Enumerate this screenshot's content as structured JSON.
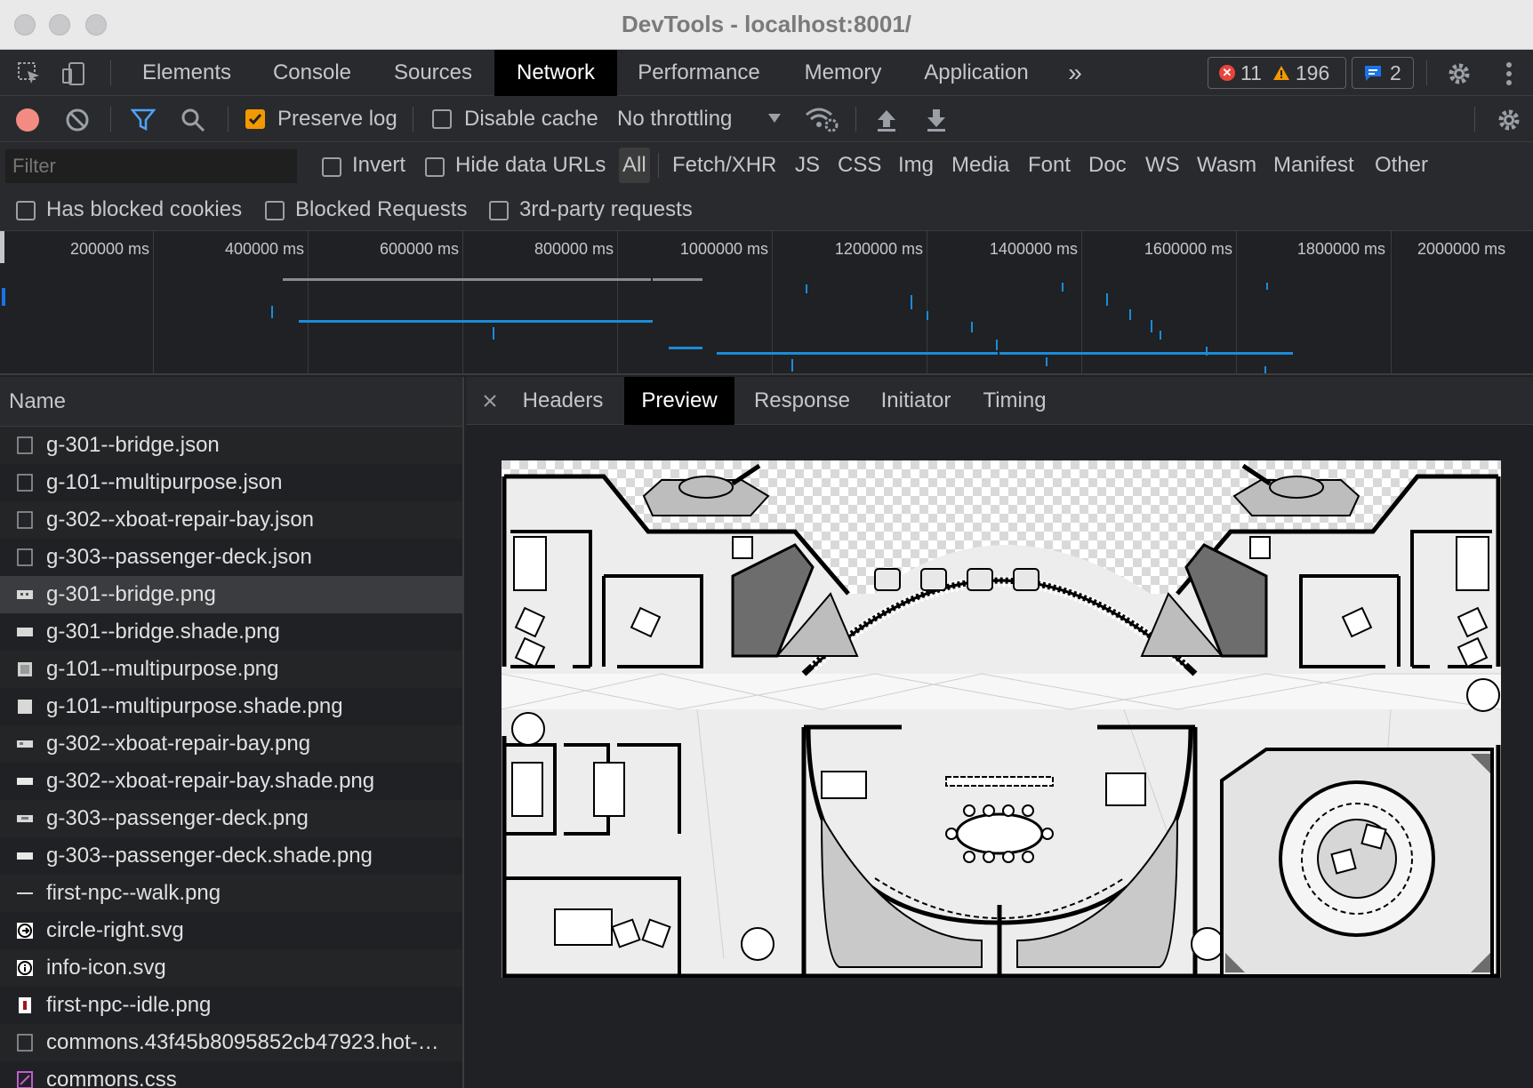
{
  "window": {
    "title": "DevTools - localhost:8001/"
  },
  "main_tabs": [
    "Elements",
    "Console",
    "Sources",
    "Network",
    "Performance",
    "Memory",
    "Application"
  ],
  "more_tabs": "»",
  "badges": {
    "errors": "11",
    "warnings": "196",
    "messages": "2"
  },
  "toolbar": {
    "preserve_log": "Preserve log",
    "disable_cache": "Disable cache",
    "throttling": "No throttling"
  },
  "filter": {
    "placeholder": "Filter",
    "invert": "Invert",
    "hide_data_urls": "Hide data URLs",
    "types": [
      "All",
      "Fetch/XHR",
      "JS",
      "CSS",
      "Img",
      "Media",
      "Font",
      "Doc",
      "WS",
      "Wasm",
      "Manifest",
      "Other"
    ]
  },
  "blocked": {
    "has_blocked_cookies": "Has blocked cookies",
    "blocked_requests": "Blocked Requests",
    "third_party": "3rd-party requests"
  },
  "timeline": {
    "labels": [
      "200000 ms",
      "400000 ms",
      "600000 ms",
      "800000 ms",
      "1000000 ms",
      "1200000 ms",
      "1400000 ms",
      "1600000 ms",
      "1800000 ms",
      "2000000 ms"
    ]
  },
  "request_list": {
    "header": "Name",
    "rows": [
      "g-301--bridge.json",
      "g-101--multipurpose.json",
      "g-302--xboat-repair-bay.json",
      "g-303--passenger-deck.json",
      "g-301--bridge.png",
      "g-301--bridge.shade.png",
      "g-101--multipurpose.png",
      "g-101--multipurpose.shade.png",
      "g-302--xboat-repair-bay.png",
      "g-302--xboat-repair-bay.shade.png",
      "g-303--passenger-deck.png",
      "g-303--passenger-deck.shade.png",
      "first-npc--walk.png",
      "circle-right.svg",
      "info-icon.svg",
      "first-npc--idle.png",
      "commons.43f45b8095852cb47923.hot-…",
      "commons.css"
    ]
  },
  "detail_tabs": [
    "Headers",
    "Preview",
    "Response",
    "Initiator",
    "Timing"
  ],
  "colors": {
    "accent": "#1a73e8",
    "warning": "#f29900",
    "error": "#e8453c"
  }
}
